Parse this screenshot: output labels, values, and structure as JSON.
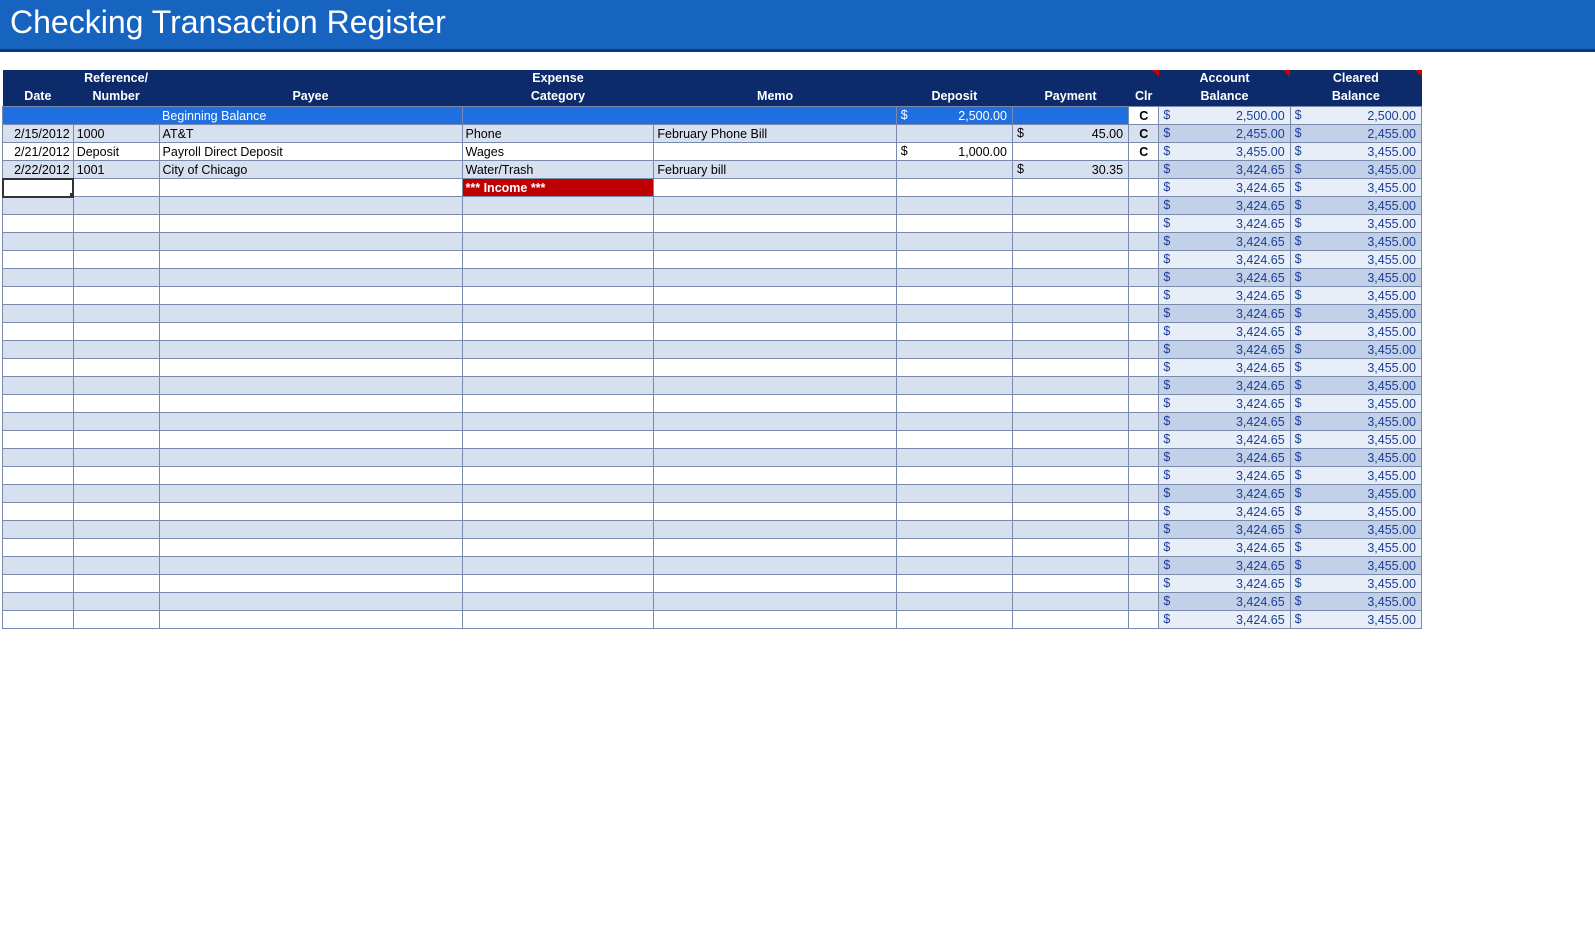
{
  "title": "Checking Transaction Register",
  "headers": {
    "date": "Date",
    "ref1": "Reference/",
    "ref2": "Number",
    "payee": "Payee",
    "cat1": "Expense",
    "cat2": "Category",
    "memo": "Memo",
    "deposit": "Deposit",
    "payment": "Payment",
    "clr": "Clr",
    "acct1": "Account",
    "acct2": "Balance",
    "clear1": "Cleared",
    "clear2": "Balance"
  },
  "begin_row": {
    "label": "Beginning Balance",
    "deposit": "2,500.00",
    "clr": "C",
    "acct": "2,500.00",
    "clear": "2,500.00"
  },
  "rows": [
    {
      "date": "2/15/2012",
      "ref": "1000",
      "payee": "AT&T",
      "cat": "Phone",
      "memo": "February Phone Bill",
      "deposit": "",
      "payment": "45.00",
      "clr": "C",
      "acct": "2,455.00",
      "clear": "2,455.00",
      "alt": true
    },
    {
      "date": "2/21/2012",
      "ref": "Deposit",
      "payee": "Payroll Direct Deposit",
      "cat": "Wages",
      "memo": "",
      "deposit": "1,000.00",
      "payment": "",
      "clr": "C",
      "acct": "3,455.00",
      "clear": "3,455.00",
      "alt": false
    },
    {
      "date": "2/22/2012",
      "ref": "1001",
      "payee": "City of Chicago",
      "cat": "Water/Trash",
      "memo": "February bill",
      "deposit": "",
      "payment": "30.35",
      "clr": "",
      "acct": "3,424.65",
      "clear": "3,455.00",
      "alt": true
    },
    {
      "date": "",
      "ref": "",
      "payee": "",
      "cat": "*** Income ***",
      "cat_red": true,
      "memo": "",
      "deposit": "",
      "payment": "",
      "clr": "",
      "acct": "3,424.65",
      "clear": "3,455.00",
      "alt": false,
      "selected": true
    },
    {
      "date": "",
      "ref": "",
      "payee": "",
      "cat": "",
      "memo": "",
      "deposit": "",
      "payment": "",
      "clr": "",
      "acct": "3,424.65",
      "clear": "3,455.00",
      "alt": true
    },
    {
      "date": "",
      "ref": "",
      "payee": "",
      "cat": "",
      "memo": "",
      "deposit": "",
      "payment": "",
      "clr": "",
      "acct": "3,424.65",
      "clear": "3,455.00",
      "alt": false
    },
    {
      "date": "",
      "ref": "",
      "payee": "",
      "cat": "",
      "memo": "",
      "deposit": "",
      "payment": "",
      "clr": "",
      "acct": "3,424.65",
      "clear": "3,455.00",
      "alt": true
    },
    {
      "date": "",
      "ref": "",
      "payee": "",
      "cat": "",
      "memo": "",
      "deposit": "",
      "payment": "",
      "clr": "",
      "acct": "3,424.65",
      "clear": "3,455.00",
      "alt": false
    },
    {
      "date": "",
      "ref": "",
      "payee": "",
      "cat": "",
      "memo": "",
      "deposit": "",
      "payment": "",
      "clr": "",
      "acct": "3,424.65",
      "clear": "3,455.00",
      "alt": true
    },
    {
      "date": "",
      "ref": "",
      "payee": "",
      "cat": "",
      "memo": "",
      "deposit": "",
      "payment": "",
      "clr": "",
      "acct": "3,424.65",
      "clear": "3,455.00",
      "alt": false
    },
    {
      "date": "",
      "ref": "",
      "payee": "",
      "cat": "",
      "memo": "",
      "deposit": "",
      "payment": "",
      "clr": "",
      "acct": "3,424.65",
      "clear": "3,455.00",
      "alt": true
    },
    {
      "date": "",
      "ref": "",
      "payee": "",
      "cat": "",
      "memo": "",
      "deposit": "",
      "payment": "",
      "clr": "",
      "acct": "3,424.65",
      "clear": "3,455.00",
      "alt": false
    },
    {
      "date": "",
      "ref": "",
      "payee": "",
      "cat": "",
      "memo": "",
      "deposit": "",
      "payment": "",
      "clr": "",
      "acct": "3,424.65",
      "clear": "3,455.00",
      "alt": true
    },
    {
      "date": "",
      "ref": "",
      "payee": "",
      "cat": "",
      "memo": "",
      "deposit": "",
      "payment": "",
      "clr": "",
      "acct": "3,424.65",
      "clear": "3,455.00",
      "alt": false
    },
    {
      "date": "",
      "ref": "",
      "payee": "",
      "cat": "",
      "memo": "",
      "deposit": "",
      "payment": "",
      "clr": "",
      "acct": "3,424.65",
      "clear": "3,455.00",
      "alt": true
    },
    {
      "date": "",
      "ref": "",
      "payee": "",
      "cat": "",
      "memo": "",
      "deposit": "",
      "payment": "",
      "clr": "",
      "acct": "3,424.65",
      "clear": "3,455.00",
      "alt": false
    },
    {
      "date": "",
      "ref": "",
      "payee": "",
      "cat": "",
      "memo": "",
      "deposit": "",
      "payment": "",
      "clr": "",
      "acct": "3,424.65",
      "clear": "3,455.00",
      "alt": true
    },
    {
      "date": "",
      "ref": "",
      "payee": "",
      "cat": "",
      "memo": "",
      "deposit": "",
      "payment": "",
      "clr": "",
      "acct": "3,424.65",
      "clear": "3,455.00",
      "alt": false
    },
    {
      "date": "",
      "ref": "",
      "payee": "",
      "cat": "",
      "memo": "",
      "deposit": "",
      "payment": "",
      "clr": "",
      "acct": "3,424.65",
      "clear": "3,455.00",
      "alt": true
    },
    {
      "date": "",
      "ref": "",
      "payee": "",
      "cat": "",
      "memo": "",
      "deposit": "",
      "payment": "",
      "clr": "",
      "acct": "3,424.65",
      "clear": "3,455.00",
      "alt": false
    },
    {
      "date": "",
      "ref": "",
      "payee": "",
      "cat": "",
      "memo": "",
      "deposit": "",
      "payment": "",
      "clr": "",
      "acct": "3,424.65",
      "clear": "3,455.00",
      "alt": true
    },
    {
      "date": "",
      "ref": "",
      "payee": "",
      "cat": "",
      "memo": "",
      "deposit": "",
      "payment": "",
      "clr": "",
      "acct": "3,424.65",
      "clear": "3,455.00",
      "alt": false
    },
    {
      "date": "",
      "ref": "",
      "payee": "",
      "cat": "",
      "memo": "",
      "deposit": "",
      "payment": "",
      "clr": "",
      "acct": "3,424.65",
      "clear": "3,455.00",
      "alt": true
    },
    {
      "date": "",
      "ref": "",
      "payee": "",
      "cat": "",
      "memo": "",
      "deposit": "",
      "payment": "",
      "clr": "",
      "acct": "3,424.65",
      "clear": "3,455.00",
      "alt": false
    },
    {
      "date": "",
      "ref": "",
      "payee": "",
      "cat": "",
      "memo": "",
      "deposit": "",
      "payment": "",
      "clr": "",
      "acct": "3,424.65",
      "clear": "3,455.00",
      "alt": true
    },
    {
      "date": "",
      "ref": "",
      "payee": "",
      "cat": "",
      "memo": "",
      "deposit": "",
      "payment": "",
      "clr": "",
      "acct": "3,424.65",
      "clear": "3,455.00",
      "alt": false
    },
    {
      "date": "",
      "ref": "",
      "payee": "",
      "cat": "",
      "memo": "",
      "deposit": "",
      "payment": "",
      "clr": "",
      "acct": "3,424.65",
      "clear": "3,455.00",
      "alt": true
    },
    {
      "date": "",
      "ref": "",
      "payee": "",
      "cat": "",
      "memo": "",
      "deposit": "",
      "payment": "",
      "clr": "",
      "acct": "3,424.65",
      "clear": "3,455.00",
      "alt": false
    }
  ],
  "currency": "$"
}
